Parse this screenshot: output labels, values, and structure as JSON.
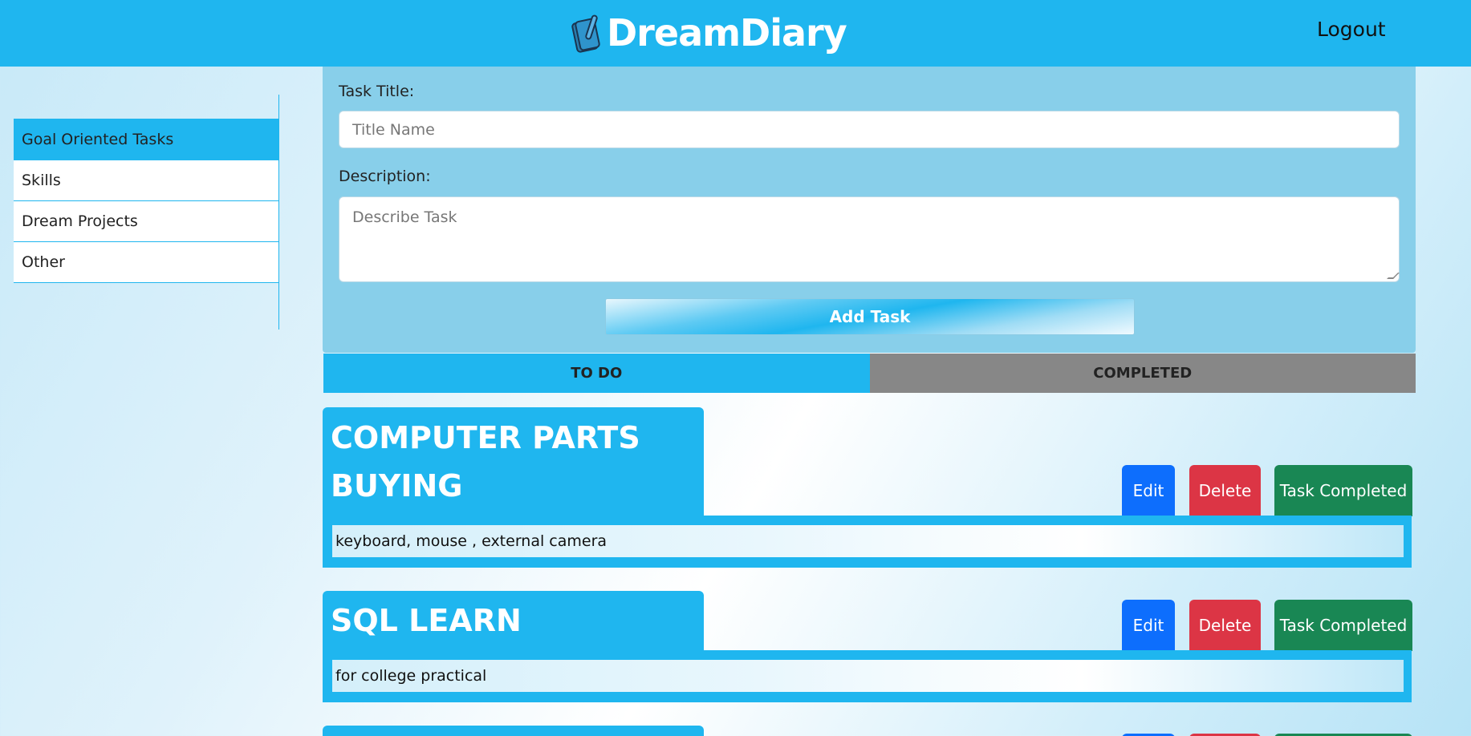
{
  "header": {
    "brand": "DreamDiary",
    "brand_icon": "notebook-pen-icon",
    "logout_label": "Logout",
    "color": "#1fb6ef"
  },
  "sidebar": {
    "items": [
      {
        "label": "Goal Oriented Tasks",
        "active": true
      },
      {
        "label": "Skills",
        "active": false
      },
      {
        "label": "Dream Projects",
        "active": false
      },
      {
        "label": "Other",
        "active": false
      }
    ]
  },
  "form": {
    "title_label": "Task Title:",
    "title_placeholder": "Title Name",
    "desc_label": "Description:",
    "desc_placeholder": "Describe Task",
    "add_button": "Add Task"
  },
  "tabs": {
    "todo": "TO DO",
    "completed": "COMPLETED"
  },
  "tasks": [
    {
      "title": "COMPUTER PARTS BUYING",
      "description": "keyboard, mouse , external camera",
      "edit": "Edit",
      "delete": "Delete",
      "complete": "Task Completed"
    },
    {
      "title": "SQL LEARN",
      "description": "for college practical",
      "edit": "Edit",
      "delete": "Delete",
      "complete": "Task Completed"
    }
  ],
  "colors": {
    "accent": "#1fb6ef",
    "edit": "#0d6efd",
    "delete": "#dc3545",
    "complete": "#198754",
    "completed_tab": "#878787"
  }
}
